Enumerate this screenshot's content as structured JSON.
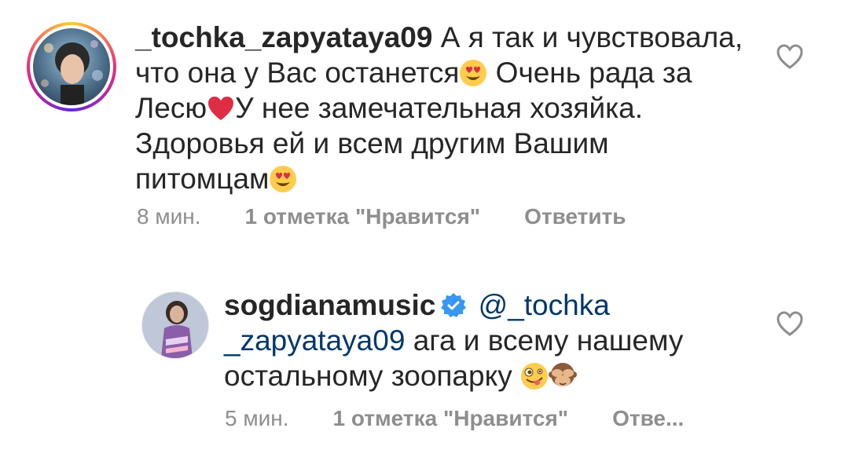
{
  "comments": [
    {
      "username": "_tochka_zapyataya09",
      "text_parts": [
        "А я так и чувствовала, что она у Вас останется",
        " Очень рада за Лесю",
        "У нее замечательная хозяйка. Здоровья ей и всем другим Вашим питомцам"
      ],
      "time": "8 мин.",
      "likes": "1 отметка \"Нравится\"",
      "reply": "Ответить"
    },
    {
      "username": "sogdianamusic",
      "verified": true,
      "mention": "@_tochka _zapyataya09",
      "text": "ага и всему нашему остальному зоопарку",
      "time": "5 мин.",
      "likes": "1 отметка \"Нравится\"",
      "reply": "Отве..."
    }
  ],
  "colors": {
    "text": "#262626",
    "meta": "#8e8e8e",
    "mention": "#00376b",
    "verified": "#3897f0",
    "heart": "#ed4956"
  },
  "icons": {
    "like": "heart-outline-icon",
    "verified": "verified-badge-icon",
    "emoji_heart_eyes": "heart-eyes-emoji",
    "emoji_red_heart": "red-heart-emoji",
    "emoji_zany": "zany-face-emoji",
    "emoji_see_no_evil": "see-no-evil-monkey-emoji"
  }
}
